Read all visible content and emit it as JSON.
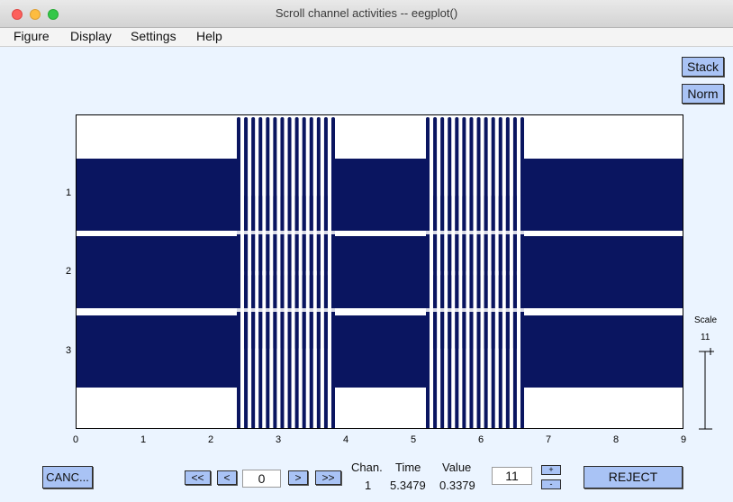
{
  "window": {
    "title": "Scroll channel activities -- eegplot()"
  },
  "menu": [
    "Figure",
    "Display",
    "Settings",
    "Help"
  ],
  "side_buttons": {
    "stack": "Stack",
    "norm": "Norm"
  },
  "plot": {
    "channels": [
      "1",
      "2",
      "3"
    ],
    "x_ticks": [
      "0",
      "1",
      "2",
      "3",
      "4",
      "5",
      "6",
      "7",
      "8",
      "9"
    ],
    "x_range": [
      0,
      9
    ],
    "trace_color": "#0a1560",
    "bursts": [
      [
        2.4,
        3.8
      ],
      [
        5.2,
        6.6
      ]
    ]
  },
  "scale": {
    "label": "Scale",
    "value": "11"
  },
  "controls": {
    "cancel": "CANC...",
    "first": "<<",
    "prev": "<",
    "position": "0",
    "next": ">",
    "last": ">>",
    "chan_header": "Chan.",
    "time_header": "Time",
    "value_header": "Value",
    "chan_value": "1",
    "time_value": "5.3479",
    "value_value": "0.3379",
    "scale_field": "11",
    "plus": "+",
    "minus": "-",
    "reject": "REJECT"
  }
}
